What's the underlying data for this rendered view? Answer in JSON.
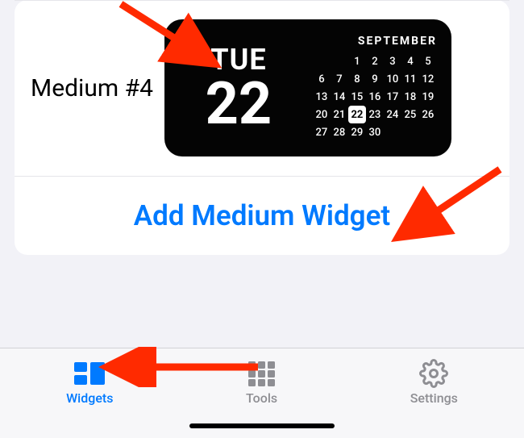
{
  "widget": {
    "label": "Medium #4",
    "day_abbr": "TUE",
    "day_num": "22",
    "month": "SEPTEMBER",
    "days_in_month": 30,
    "first_day_column": 2,
    "today": 22
  },
  "add_button": "Add Medium Widget",
  "tabs": {
    "widgets": "Widgets",
    "tools": "Tools",
    "settings": "Settings"
  },
  "colors": {
    "accent": "#007aff",
    "inactive": "#8e8e93"
  }
}
